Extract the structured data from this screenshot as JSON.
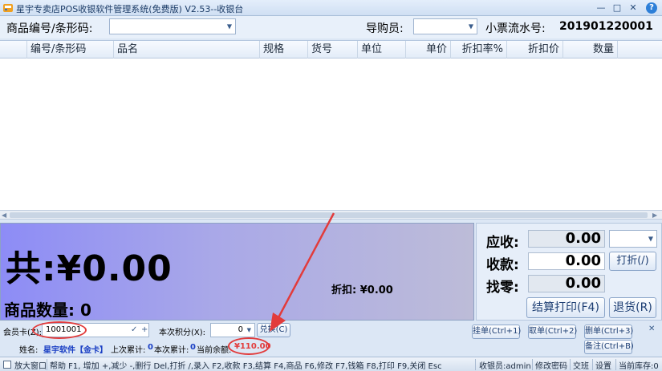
{
  "window": {
    "title": "星宇专卖店POS收银软件管理系统(免费版) V2.53--收银台",
    "minimize_glyph": "—",
    "maximize_glyph": "□",
    "close_glyph": "✕",
    "help_glyph": "?"
  },
  "search": {
    "code_label": "商品编号/条形码:",
    "code_value": "",
    "guide_label": "导购员:",
    "guide_value": "",
    "receipt_label": "小票流水号:",
    "receipt_value": "201901220001"
  },
  "grid": {
    "columns": [
      "编号/条形码",
      "品名",
      "规格",
      "货号",
      "单位",
      "单价",
      "折扣率%",
      "折扣价",
      "数量"
    ],
    "rows": []
  },
  "totals": {
    "total_text": "共:¥0.00",
    "qty_text": "商品数量: 0",
    "discount_text": "折扣: ¥0.00"
  },
  "payment": {
    "due_label": "应收:",
    "due_value": "0.00",
    "paid_label": "收款:",
    "paid_value": "0.00",
    "change_label": "找零:",
    "change_value": "0.00",
    "discount_btn": "打折(/)",
    "checkout_btn": "结算打印(F4)",
    "return_btn": "退货(R)"
  },
  "member": {
    "card_label": "会员卡(Z):",
    "card_value": "1001001",
    "points_label": "本次积分(X):",
    "points_value": "0",
    "redeem_btn": "兑换(C)",
    "name_label": "姓名:",
    "name_value": "星宇软件【金卡】",
    "last_total_label": "上次累计:",
    "last_total_value": "0",
    "this_total_label": "本次累计:",
    "this_total_value": "0",
    "balance_label": "当前余额:",
    "balance_value": "¥110.00"
  },
  "actions": {
    "hang_btn": "挂单(Ctrl+1)",
    "take_btn": "取单(Ctrl+2)",
    "delete_btn": "删单(Ctrl+3)",
    "note_btn": "备注(Ctrl+B)",
    "close_glyph": "✕"
  },
  "status": {
    "zoom_btn": "放大窗口",
    "help_text": "帮助 F1, 增加 +,减少 -,删行 Del,打折 /,录入 F2,收款 F3,结算 F4,商品 F6,修改 F7,钱箱 F8,打印 F9,关闭 Esc",
    "cashier": "收银员:admin",
    "change_pwd": "修改密码",
    "shift": "交班",
    "settings": "设置",
    "stock": "当前库存:0"
  },
  "colors": {
    "accent": "#1d3e73",
    "balance_red": "#e23b3b",
    "member_blue": "#1a3fc4"
  }
}
